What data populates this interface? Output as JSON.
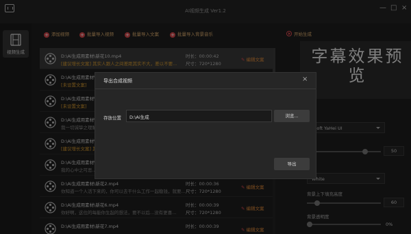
{
  "window": {
    "title": "AI视频生成 Ver1.2",
    "minimize_glyph": "—",
    "maximize_glyph": "□",
    "close_glyph": "×"
  },
  "nav": {
    "label": "视频生成",
    "icon": "film-icon"
  },
  "toolbar": {
    "add_video": "添加视频",
    "batch_import_video": "批量导入视频",
    "batch_import_text": "批量导入文案",
    "batch_import_music": "批量导入背景音乐",
    "start": "开始生成"
  },
  "videos": [
    {
      "path": "D:\\Ai生成用素材\\新花10.mp4",
      "text": "[建议增长文案] 其实人跟人之间差距其实不大，差以不要...",
      "duration_label": "时长：",
      "duration": "00:00:42",
      "res_label": "尺寸：",
      "resolution": "720*1280",
      "edit": "编辑文案",
      "selected": true,
      "text_grey": false
    },
    {
      "path": "D:\\Ai生成用素材\\新花...",
      "text": "[未设置文案]",
      "duration_label": "",
      "duration": "",
      "res_label": "",
      "resolution": "",
      "edit": "",
      "selected": false,
      "text_grey": false
    },
    {
      "path": "D:\\Ai生成用素材\\新花...",
      "text": "[未设置文案]",
      "duration_label": "",
      "duration": "",
      "res_label": "",
      "resolution": "",
      "edit": "",
      "selected": false,
      "text_grey": false
    },
    {
      "path": "D:\\Ai生成用素材\\新花...",
      "text": "我一切诚挚之理解...",
      "duration_label": "",
      "duration": "",
      "res_label": "",
      "resolution": "",
      "edit": "",
      "selected": false,
      "text_grey": true
    },
    {
      "path": "D:\\Ai生成用素材\\新花...",
      "text": "[建议增长文案] 其...",
      "duration_label": "",
      "duration": "",
      "res_label": "",
      "resolution": "",
      "edit": "",
      "selected": false,
      "text_grey": false
    },
    {
      "path": "D:\\Ai生成用素材\\新花...",
      "text": "我的心中之可恶...",
      "duration_label": "",
      "duration": "",
      "res_label": "",
      "resolution": "",
      "edit": "",
      "selected": false,
      "text_grey": true
    },
    {
      "path": "D:\\Ai生成用素材\\新花2.mp4",
      "text": "你知道一个人活下来的，你可以去干什么工作一起稳钱，就要...",
      "duration_label": "时长：",
      "duration": "00:00:36",
      "res_label": "尺寸：",
      "resolution": "720*1280",
      "edit": "编辑文案",
      "selected": false,
      "text_grey": true
    },
    {
      "path": "D:\\Ai生成用素材\\新花6.mp4",
      "text": "你好啊，这位的每能你生起的想法，要不以后...没有更喜...",
      "duration_label": "时长：",
      "duration": "00:00:39",
      "res_label": "尺寸：",
      "resolution": "720*1280",
      "edit": "编辑文案",
      "selected": false,
      "text_grey": true
    },
    {
      "path": "D:\\Ai生成用素材\\新花7.mp4",
      "text": "",
      "duration_label": "时长：",
      "duration": "00:00:39",
      "res_label": "",
      "resolution": "",
      "edit": "编辑文案",
      "selected": false,
      "text_grey": true
    }
  ],
  "preview": {
    "title": "字幕效果预览",
    "font": "osoft YaHei UI",
    "font_size": "50",
    "color": "White",
    "bg_padding_label": "背景上下填充高度",
    "bg_padding": "60",
    "opacity_label": "背景透明度",
    "opacity": "0%",
    "font_size_level": 0.75,
    "bg_padding_level": 0.1,
    "opacity_level": 0.0
  },
  "dialog": {
    "title": "导出合成视频",
    "close": "×",
    "path_label": "存放位置",
    "path_value": "D:\\Ai生成",
    "browse": "浏览...",
    "export": "导出"
  },
  "colors": {
    "accent_orange": "#e0b070",
    "accent_red": "#d6454a",
    "warning_text": "#d89c30"
  }
}
